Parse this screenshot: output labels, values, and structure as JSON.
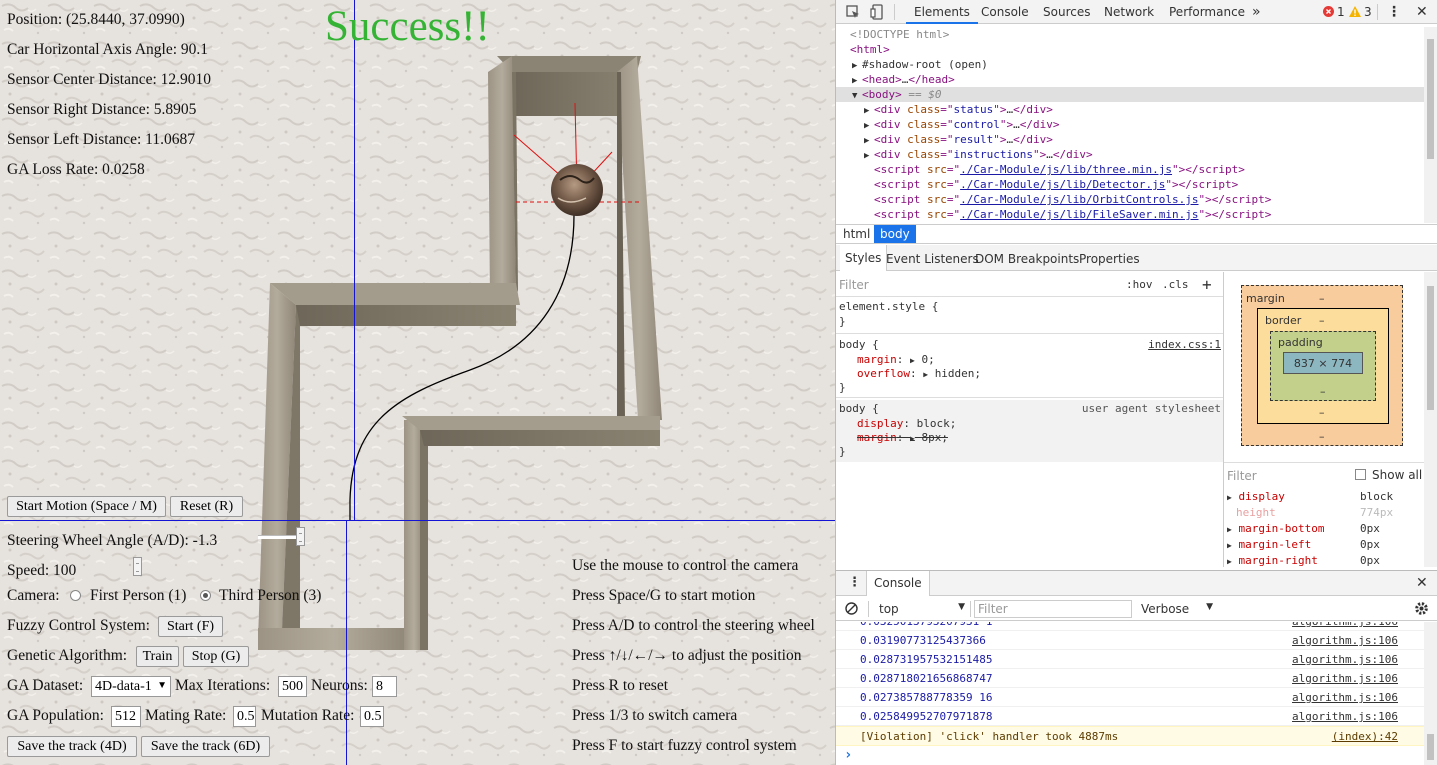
{
  "overlay": {
    "success": "Success!!",
    "position": "Position: (25.8440, 37.0990)",
    "angle": "Car Horizontal Axis Angle: 90.1",
    "sensor_center": "Sensor Center Distance: 12.9010",
    "sensor_right": "Sensor Right Distance: 5.8905",
    "sensor_left": "Sensor Left Distance: 11.0687",
    "ga_loss": "GA Loss Rate: 0.0258"
  },
  "controls": {
    "start_motion": "Start Motion (Space / M)",
    "reset": "Reset (R)",
    "steering": "Steering Wheel Angle (A/D): -1.3",
    "speed": "Speed: 100",
    "camera_label": "Camera:",
    "camera_first": "First Person (1)",
    "camera_third": "Third Person (3)",
    "fuzzy_label": "Fuzzy Control System:",
    "fuzzy_start": "Start (F)",
    "ga_label": "Genetic Algorithm:",
    "ga_train": "Train",
    "ga_stop": "Stop (G)",
    "dataset_label": "GA Dataset:",
    "dataset_value": "4D-data-1",
    "max_iter_label": "Max Iterations:",
    "max_iter_value": "500",
    "neurons_label": "Neurons:",
    "neurons_value": "8",
    "population_label": "GA Population:",
    "population_value": "512",
    "mating_label": "Mating Rate:",
    "mating_value": "0.5",
    "mutation_label": "Mutation Rate:",
    "mutation_value": "0.5",
    "save_4d": "Save the track (4D)",
    "save_6d": "Save the track (6D)"
  },
  "instructions": [
    "Use the mouse to control the camera",
    "Press Space/G to start motion",
    "Press A/D to control the steering wheel",
    "Press ↑/↓/←/→ to adjust the position",
    "Press R to reset",
    "Press 1/3 to switch camera",
    "Press F to start fuzzy control system"
  ],
  "devtools": {
    "tabs": [
      "Elements",
      "Console",
      "Sources",
      "Network",
      "Performance"
    ],
    "active_tab": "Elements",
    "more_tabs": "»",
    "error_count": "1",
    "warning_count": "3",
    "elements": {
      "doctype": "<!DOCTYPE html>",
      "html_open": "<html>",
      "shadow": "#shadow-root (open)",
      "head": "head",
      "body_selected_suffix": "== $0",
      "divs": [
        {
          "class": "status"
        },
        {
          "class": "control"
        },
        {
          "class": "result"
        },
        {
          "class": "instructions"
        }
      ],
      "scripts": [
        "./Car-Module/js/lib/three.min.js",
        "./Car-Module/js/lib/Detector.js",
        "./Car-Module/js/lib/OrbitControls.js",
        "./Car-Module/js/lib/FileSaver.min.js"
      ]
    },
    "breadcrumbs": [
      "html",
      "body"
    ],
    "subtabs": [
      "Styles",
      "Event Listeners",
      "DOM Breakpoints",
      "Properties"
    ],
    "filter_placeholder": "Filter",
    "hov": ":hov",
    "cls": ".cls",
    "plus": "+",
    "element_style": "element.style {",
    "rule1": {
      "selector": "body {",
      "source": "index.css:1",
      "props": [
        {
          "name": "margin",
          "value": "0;"
        },
        {
          "name": "overflow",
          "value": "hidden;"
        }
      ]
    },
    "rule2": {
      "selector": "body {",
      "source": "user agent stylesheet",
      "props": [
        {
          "name": "display",
          "value": "block;"
        },
        {
          "name": "margin",
          "value": "8px;"
        }
      ]
    },
    "boxmodel": {
      "margin_label": "margin",
      "border_label": "border",
      "padding_label": "padding",
      "content": "837 × 774",
      "dash": "–"
    },
    "computed": {
      "filter": "Filter",
      "show_all": "Show all",
      "props": [
        {
          "name": "display",
          "value": "block",
          "muted": false
        },
        {
          "name": "height",
          "value": "774px",
          "muted": true
        },
        {
          "name": "margin-bottom",
          "value": "0px",
          "muted": false
        },
        {
          "name": "margin-left",
          "value": "0px",
          "muted": false
        },
        {
          "name": "margin-right",
          "value": "0px",
          "muted": false
        }
      ]
    },
    "console": {
      "title": "Console",
      "context": "top",
      "filter_placeholder": "Filter",
      "level": "Verbose",
      "lines": [
        {
          "value": "0.0319077312543736​6",
          "source": "algorithm.js:106"
        },
        {
          "value": "0.028731957532151485",
          "source": "algorithm.js:106"
        },
        {
          "value": "0.028718021656868747",
          "source": "algorithm.js:106"
        },
        {
          "value": "0.027385788778359 16",
          "source": "algorithm.js:106"
        },
        {
          "value": "0.025849952707971878",
          "source": "algorithm.js:106"
        }
      ],
      "violation": "[Violation] 'click' handler took 4887ms",
      "violation_source": "(index):42",
      "prompt": "›"
    }
  }
}
